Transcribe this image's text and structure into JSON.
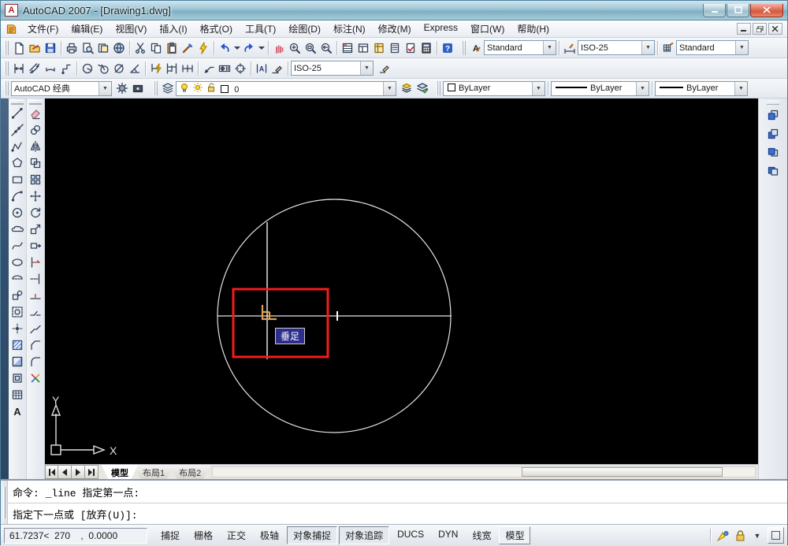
{
  "titlebar": {
    "title": "AutoCAD 2007 - [Drawing1.dwg]"
  },
  "menubar": {
    "items": [
      "文件(F)",
      "编辑(E)",
      "视图(V)",
      "插入(I)",
      "格式(O)",
      "工具(T)",
      "绘图(D)",
      "标注(N)",
      "修改(M)",
      "Express",
      "窗口(W)",
      "帮助(H)"
    ]
  },
  "toolbars": {
    "standard": {
      "icons": [
        "new-file",
        "open-file",
        "save",
        "|",
        "plot",
        "plot-preview",
        "publish",
        "web",
        "|",
        "cut",
        "copy",
        "paste",
        "match-properties",
        "block-editor",
        "|",
        "undo",
        "dropdown",
        "redo",
        "dropdown",
        "|",
        "pan",
        "zoom-realtime",
        "zoom-window",
        "zoom-previous",
        "|",
        "properties",
        "designcenter",
        "tool-palettes",
        "sheetset-manager",
        "markup-manager",
        "quick-calc",
        "|",
        "help"
      ]
    },
    "styles": {
      "text_style": "Standard",
      "dim_style": "ISO-25",
      "table_style": "Standard"
    },
    "dimension": {
      "icons": [
        "dim-linear",
        "dim-aligned",
        "dim-arclength",
        "dim-ordinate",
        "|",
        "dim-radius",
        "dim-jogged",
        "dim-diameter",
        "dim-angular",
        "|",
        "qdim",
        "dim-baseline",
        "dim-continue",
        "|",
        "quick-leader",
        "tolerance",
        "center-mark",
        "|",
        "dim-text-edit",
        "dim-edit"
      ],
      "style_value": "ISO-25"
    },
    "workspaces": {
      "value": "AutoCAD 经典",
      "icons": [
        "workspace-settings",
        "save-workspace"
      ]
    },
    "layers": {
      "current_layer": "0",
      "after_icons": [
        "layer-previous",
        "layer-states"
      ]
    },
    "properties": {
      "color_value": "ByLayer",
      "linetype_value": "ByLayer",
      "lineweight_value": "ByLayer"
    }
  },
  "draw_toolbar": {
    "icons": [
      "line",
      "construction-line",
      "polyline",
      "polygon",
      "rectangle",
      "arc",
      "circle",
      "revcloud",
      "spline",
      "ellipse",
      "ellipse-arc",
      "insert-block",
      "make-block",
      "point",
      "hatch",
      "gradient",
      "region",
      "table",
      "mtext"
    ]
  },
  "modify_toolbar": {
    "icons": [
      "erase",
      "copy-objects",
      "mirror",
      "offset",
      "array",
      "move",
      "rotate",
      "scale",
      "stretch",
      "trim",
      "extend",
      "break-at-point",
      "break",
      "join",
      "chamfer",
      "fillet",
      "explode"
    ]
  },
  "draworder_toolbar": {
    "icons": [
      "draworder-front",
      "draworder-back",
      "draworder-above",
      "draworder-under"
    ]
  },
  "canvas": {
    "osnap_tooltip": "垂足",
    "ucs": {
      "x_label": "X",
      "y_label": "Y"
    }
  },
  "layout_tabs": {
    "tabs": [
      {
        "label": "模型",
        "active": true
      },
      {
        "label": "布局1",
        "active": false
      },
      {
        "label": "布局2",
        "active": false
      }
    ]
  },
  "command_line": {
    "history": "命令: _line 指定第一点:",
    "prompt": "指定下一点或  [放弃(U)]:"
  },
  "status_bar": {
    "coordinates": "61.7237<  270    ,  0.0000",
    "toggles": [
      {
        "label": "捕捉",
        "on": false
      },
      {
        "label": "栅格",
        "on": false
      },
      {
        "label": "正交",
        "on": false
      },
      {
        "label": "极轴",
        "on": false
      },
      {
        "label": "对象捕捉",
        "on": true
      },
      {
        "label": "对象追踪",
        "on": true
      },
      {
        "label": "DUCS",
        "on": false
      },
      {
        "label": "DYN",
        "on": false
      },
      {
        "label": "线宽",
        "on": false
      }
    ],
    "model_button": "模型"
  }
}
